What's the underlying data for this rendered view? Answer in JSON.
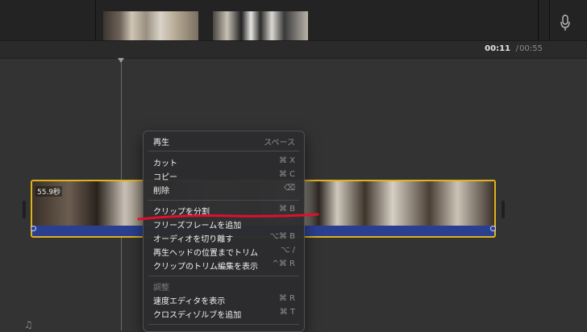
{
  "time_display": {
    "current": "00:11",
    "separator": "/",
    "total": "00:55"
  },
  "clip": {
    "duration_label": "55.9秒"
  },
  "context_menu": {
    "items": [
      {
        "label": "再生",
        "shortcut": "スペース"
      },
      {
        "label": "カット",
        "shortcut": "⌘ X"
      },
      {
        "label": "コピー",
        "shortcut": "⌘ C"
      },
      {
        "label": "削除",
        "shortcut": "⌫"
      },
      {
        "label": "クリップを分割",
        "shortcut": "⌘ B"
      },
      {
        "label": "フリーズフレームを追加",
        "shortcut": ""
      },
      {
        "label": "オーディオを切り離す",
        "shortcut": "⌥⌘ B"
      },
      {
        "label": "再生ヘッドの位置までトリム",
        "shortcut": "⌥ /"
      },
      {
        "label": "クリップのトリム編集を表示",
        "shortcut": "^⌘ R"
      },
      {
        "label": "調整",
        "shortcut": ""
      },
      {
        "label": "速度エディタを表示",
        "shortcut": "⌘ R"
      },
      {
        "label": "クロスディゾルブを追加",
        "shortcut": "⌘ T"
      }
    ]
  },
  "colors": {
    "clip_border": "#e0b21a",
    "annotation": "#e0102a",
    "audio_track": "#2a3f8f"
  },
  "icons": {
    "mic": "microphone-icon",
    "audio_lane": "music-note-icon"
  }
}
